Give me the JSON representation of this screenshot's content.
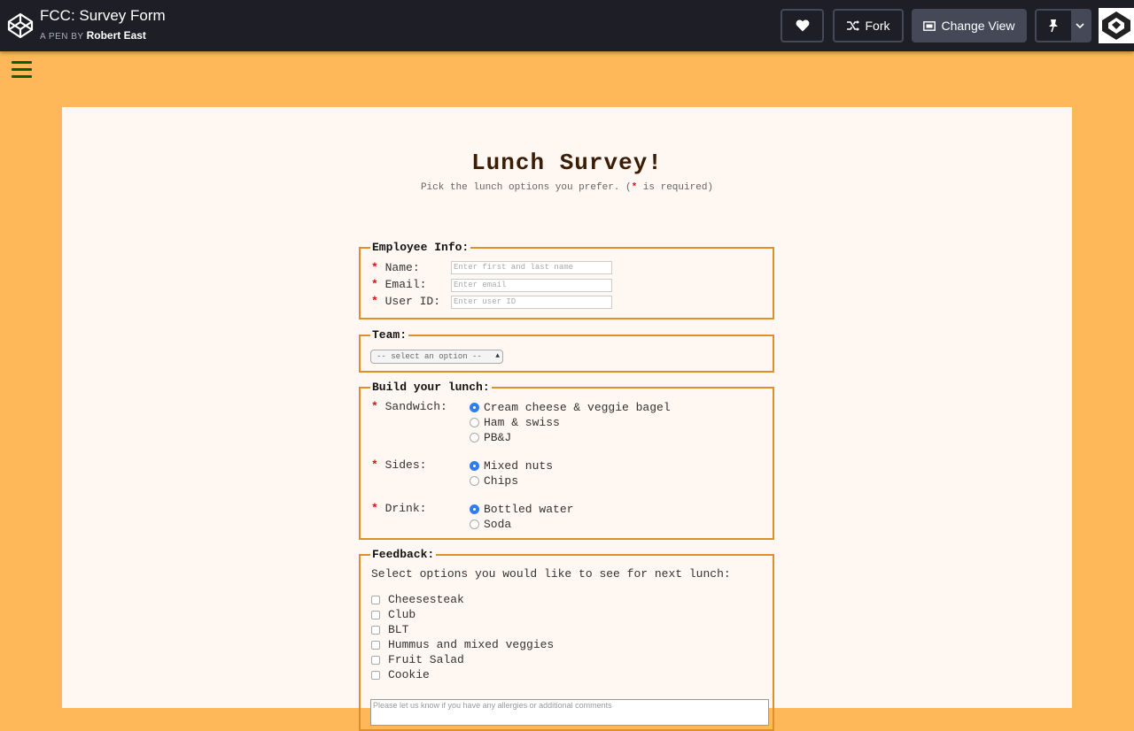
{
  "codepen": {
    "pen_title": "FCC: Survey Form",
    "pen_by_label": "A PEN BY",
    "author": "Robert East",
    "fork_label": "Fork",
    "change_view_label": "Change View",
    "colors": {
      "header_bg": "#1e1f26",
      "button_border": "#444857"
    }
  },
  "page": {
    "background": "#feb759",
    "title": "Lunch Survey!",
    "subtitle_prefix": "Pick the lunch options you prefer. (",
    "subtitle_star": "*",
    "subtitle_suffix": " is required)"
  },
  "employee": {
    "legend": "Employee Info:",
    "fields": [
      {
        "label": "Name:",
        "placeholder": "Enter first and last name"
      },
      {
        "label": "Email:",
        "placeholder": "Enter email"
      },
      {
        "label": "User ID:",
        "placeholder": "Enter user ID"
      }
    ]
  },
  "team": {
    "legend": "Team:",
    "selected": "-- select an option --"
  },
  "lunch": {
    "legend": "Build your lunch:",
    "sandwich": {
      "label": "Sandwich:",
      "options": [
        "Cream cheese & veggie bagel",
        "Ham & swiss",
        "PB&J"
      ],
      "selected": "Cream cheese & veggie bagel"
    },
    "sides": {
      "label": "Sides:",
      "options": [
        "Mixed nuts",
        "Chips"
      ],
      "selected": "Mixed nuts"
    },
    "drink": {
      "label": "Drink:",
      "options": [
        "Bottled water",
        "Soda"
      ],
      "selected": "Bottled water"
    }
  },
  "feedback": {
    "legend": "Feedback:",
    "prompt": "Select options you would like to see for next lunch:",
    "options": [
      "Cheesesteak",
      "Club",
      "BLT",
      "Hummus and mixed veggies",
      "Fruit Salad",
      "Cookie"
    ],
    "comments_placeholder": "Please let us know if you have any allergies or additional comments"
  },
  "required_mark": "*"
}
